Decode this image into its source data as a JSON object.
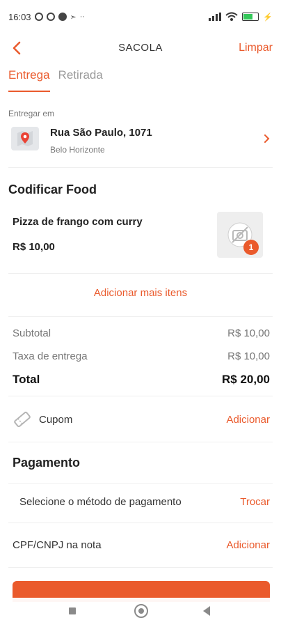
{
  "status_bar": {
    "time": "16:03",
    "dots": "··"
  },
  "header": {
    "title": "SACOLA",
    "clear_label": "Limpar"
  },
  "tabs": [
    {
      "label": "Entrega",
      "active": true
    },
    {
      "label": "Retirada",
      "active": false
    }
  ],
  "delivery": {
    "label": "Entregar em",
    "street": "Rua São Paulo, 1071",
    "city": "Belo Horizonte"
  },
  "store": {
    "name": "Codificar Food"
  },
  "item": {
    "name": "Pizza de frango com curry",
    "price": "R$ 10,00",
    "quantity": "1"
  },
  "add_more_label": "Adicionar mais itens",
  "summary": {
    "subtotal_label": "Subtotal",
    "subtotal_value": "R$ 10,00",
    "fee_label": "Taxa de entrega",
    "fee_value": "R$ 10,00",
    "total_label": "Total",
    "total_value": "R$ 20,00"
  },
  "coupon": {
    "label": "Cupom",
    "action": "Adicionar"
  },
  "payment": {
    "title": "Pagamento",
    "method_label": "Selecione o método de pagamento",
    "method_action": "Trocar",
    "cpf_label": "CPF/CNPJ na nota",
    "cpf_action": "Adicionar"
  },
  "colors": {
    "accent": "#ea5a2c",
    "muted": "#777777",
    "divider": "#efefef"
  },
  "icons": [
    "back-arrow-icon",
    "map-pin-icon",
    "chevron-right-icon",
    "no-photo-icon",
    "ticket-icon"
  ]
}
